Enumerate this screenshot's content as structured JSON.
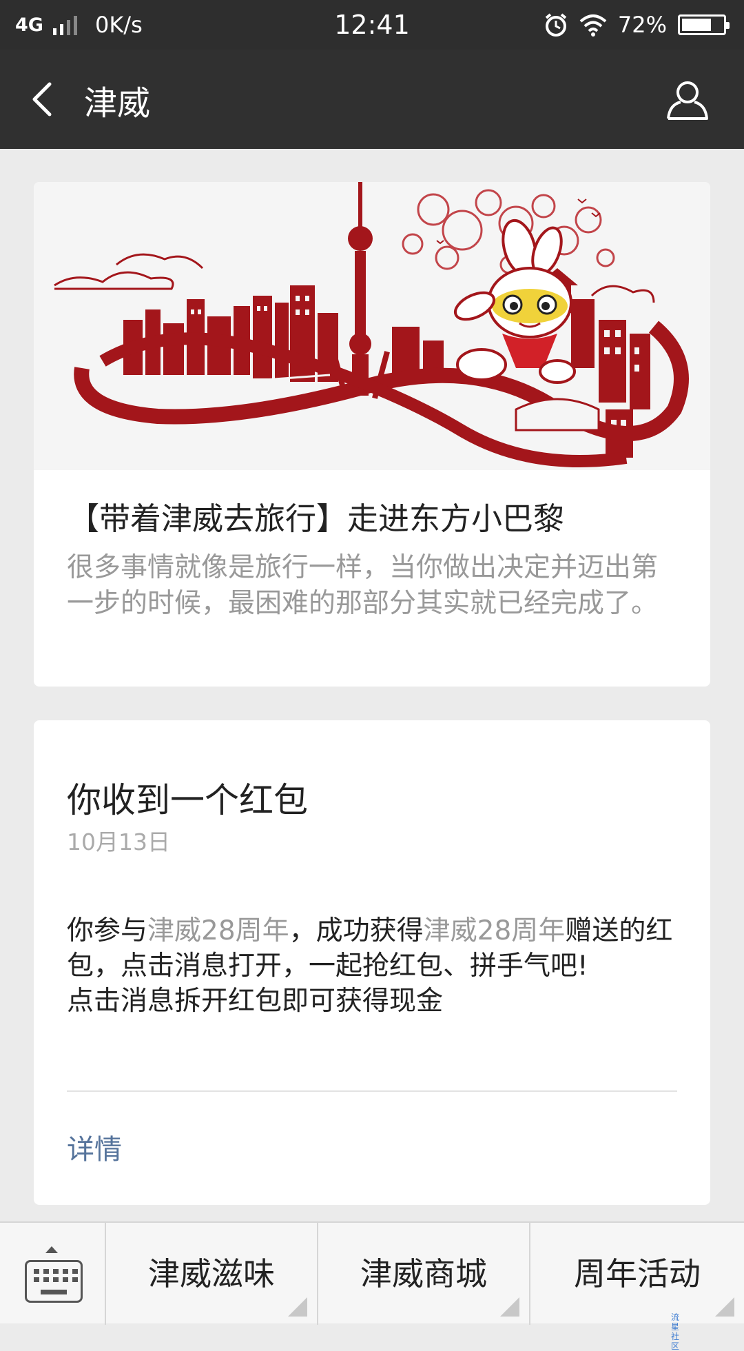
{
  "status_bar": {
    "network": "4G",
    "speed": "0K/s",
    "time": "12:41",
    "battery": "72%",
    "battery_level": 0.72
  },
  "nav": {
    "title": "津威"
  },
  "article_card": {
    "title": "【带着津威去旅行】走进东方小巴黎",
    "description": "很多事情就像是旅行一样，当你做出决定并迈出第一步的时候，最困难的那部分其实就已经完成了。"
  },
  "redpacket_card": {
    "title": "你收到一个红包",
    "date": "10月13日",
    "body_part1": "你参与",
    "highlight1": "津威28周年",
    "body_part2": "，成功获得",
    "highlight2": "津威28周年",
    "body_part3": "赠送的红包，点击消息打开，一起抢红包、拼手气吧!",
    "body_line2": "点击消息拆开红包即可获得现金",
    "link": "详情"
  },
  "bottom_menu": {
    "items": [
      "津威滋味",
      "津威商城",
      "周年活动"
    ]
  },
  "watermark": "流星社区",
  "colors": {
    "nav_bg": "#303030",
    "link": "#55739b",
    "highlight_text": "#999999",
    "hero_red": "#a3161b"
  }
}
